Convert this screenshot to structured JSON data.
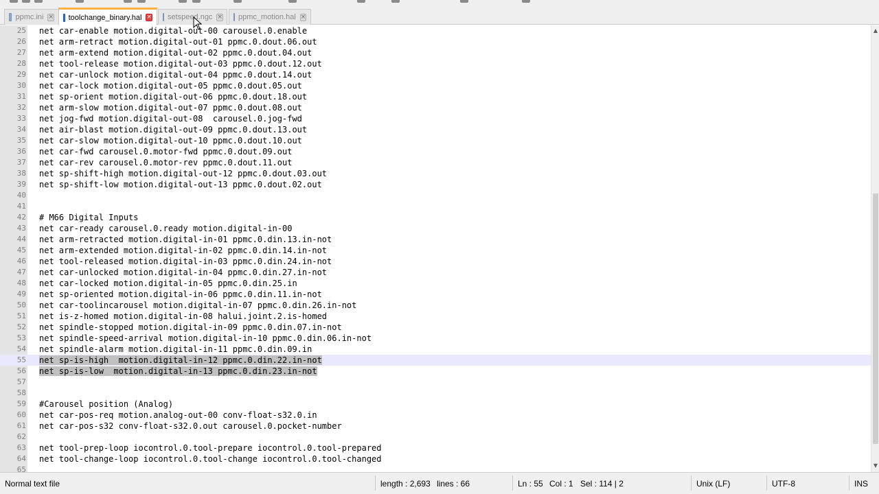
{
  "tabs": [
    {
      "label": "ppmc.ini",
      "active": false
    },
    {
      "label": "toolchange_binary.hal",
      "active": true
    },
    {
      "label": "setspeed.ngc",
      "active": false
    },
    {
      "label": "ppmc_motion.hal",
      "active": false
    }
  ],
  "editor": {
    "current_line": 55,
    "lines": [
      {
        "num": "25",
        "text": "net car-enable motion.digital-out-00 carousel.0.enable"
      },
      {
        "num": "26",
        "text": "net arm-retract motion.digital-out-01 ppmc.0.dout.06.out"
      },
      {
        "num": "27",
        "text": "net arm-extend motion.digital-out-02 ppmc.0.dout.04.out"
      },
      {
        "num": "28",
        "text": "net tool-release motion.digital-out-03 ppmc.0.dout.12.out"
      },
      {
        "num": "29",
        "text": "net car-unlock motion.digital-out-04 ppmc.0.dout.14.out"
      },
      {
        "num": "30",
        "text": "net car-lock motion.digital-out-05 ppmc.0.dout.05.out"
      },
      {
        "num": "31",
        "text": "net sp-orient motion.digital-out-06 ppmc.0.dout.18.out"
      },
      {
        "num": "32",
        "text": "net arm-slow motion.digital-out-07 ppmc.0.dout.08.out"
      },
      {
        "num": "33",
        "text": "net jog-fwd motion.digital-out-08  carousel.0.jog-fwd"
      },
      {
        "num": "34",
        "text": "net air-blast motion.digital-out-09 ppmc.0.dout.13.out"
      },
      {
        "num": "35",
        "text": "net car-slow motion.digital-out-10 ppmc.0.dout.10.out"
      },
      {
        "num": "36",
        "text": "net car-fwd carousel.0.motor-fwd ppmc.0.dout.09.out"
      },
      {
        "num": "37",
        "text": "net car-rev carousel.0.motor-rev ppmc.0.dout.11.out"
      },
      {
        "num": "38",
        "text": "net sp-shift-high motion.digital-out-12 ppmc.0.dout.03.out"
      },
      {
        "num": "39",
        "text": "net sp-shift-low motion.digital-out-13 ppmc.0.dout.02.out"
      },
      {
        "num": "40",
        "text": ""
      },
      {
        "num": "41",
        "text": ""
      },
      {
        "num": "42",
        "text": "# M66 Digital Inputs"
      },
      {
        "num": "43",
        "text": "net car-ready carousel.0.ready motion.digital-in-00"
      },
      {
        "num": "44",
        "text": "net arm-retracted motion.digital-in-01 ppmc.0.din.13.in-not"
      },
      {
        "num": "45",
        "text": "net arm-extended motion.digital-in-02 ppmc.0.din.14.in-not"
      },
      {
        "num": "46",
        "text": "net tool-released motion.digital-in-03 ppmc.0.din.24.in-not"
      },
      {
        "num": "47",
        "text": "net car-unlocked motion.digital-in-04 ppmc.0.din.27.in-not"
      },
      {
        "num": "48",
        "text": "net car-locked motion.digital-in-05 ppmc.0.din.25.in"
      },
      {
        "num": "49",
        "text": "net sp-oriented motion.digital-in-06 ppmc.0.din.11.in-not"
      },
      {
        "num": "50",
        "text": "net car-toolincarousel motion.digital-in-07 ppmc.0.din.26.in-not"
      },
      {
        "num": "51",
        "text": "net is-z-homed motion.digital-in-08 halui.joint.2.is-homed"
      },
      {
        "num": "52",
        "text": "net spindle-stopped motion.digital-in-09 ppmc.0.din.07.in-not"
      },
      {
        "num": "53",
        "text": "net spindle-speed-arrival motion.digital-in-10 ppmc.0.din.06.in-not"
      },
      {
        "num": "54",
        "text": "net spindle-alarm motion.digital-in-11 ppmc.0.din.09.in"
      },
      {
        "num": "55",
        "text": "net sp-is-high  motion.digital-in-12 ppmc.0.din.22.in-not",
        "selected": true
      },
      {
        "num": "56",
        "text": "net sp-is-low  motion.digital-in-13 ppmc.0.din.23.in-not",
        "selected": true
      },
      {
        "num": "57",
        "text": ""
      },
      {
        "num": "58",
        "text": ""
      },
      {
        "num": "59",
        "text": "#Carousel position (Analog)"
      },
      {
        "num": "60",
        "text": "net car-pos-req motion.analog-out-00 conv-float-s32.0.in"
      },
      {
        "num": "61",
        "text": "net car-pos-s32 conv-float-s32.0.out carousel.0.pocket-number"
      },
      {
        "num": "62",
        "text": ""
      },
      {
        "num": "63",
        "text": "net tool-prep-loop iocontrol.0.tool-prepare iocontrol.0.tool-prepared"
      },
      {
        "num": "64",
        "text": "net tool-change-loop iocontrol.0.tool-change iocontrol.0.tool-changed"
      },
      {
        "num": "65",
        "text": ""
      }
    ]
  },
  "statusbar": {
    "file_type": "Normal text file",
    "length": "length : 2,693",
    "lines": "lines : 66",
    "ln": "Ln : 55",
    "col": "Col : 1",
    "sel": "Sel : 114 | 2",
    "eol": "Unix (LF)",
    "encoding": "UTF-8",
    "mode": "INS"
  },
  "colors": {
    "active_tab_accent": "#fab041",
    "current_line_bg": "#e8e8ff",
    "selection_bg": "#c0c0c0"
  },
  "icons": {
    "tab_file": "file-icon",
    "tab_close": "close-icon",
    "scroll_up": "arrow-up-icon",
    "scroll_down": "arrow-down-icon",
    "pointer": "mouse-pointer-icon"
  }
}
